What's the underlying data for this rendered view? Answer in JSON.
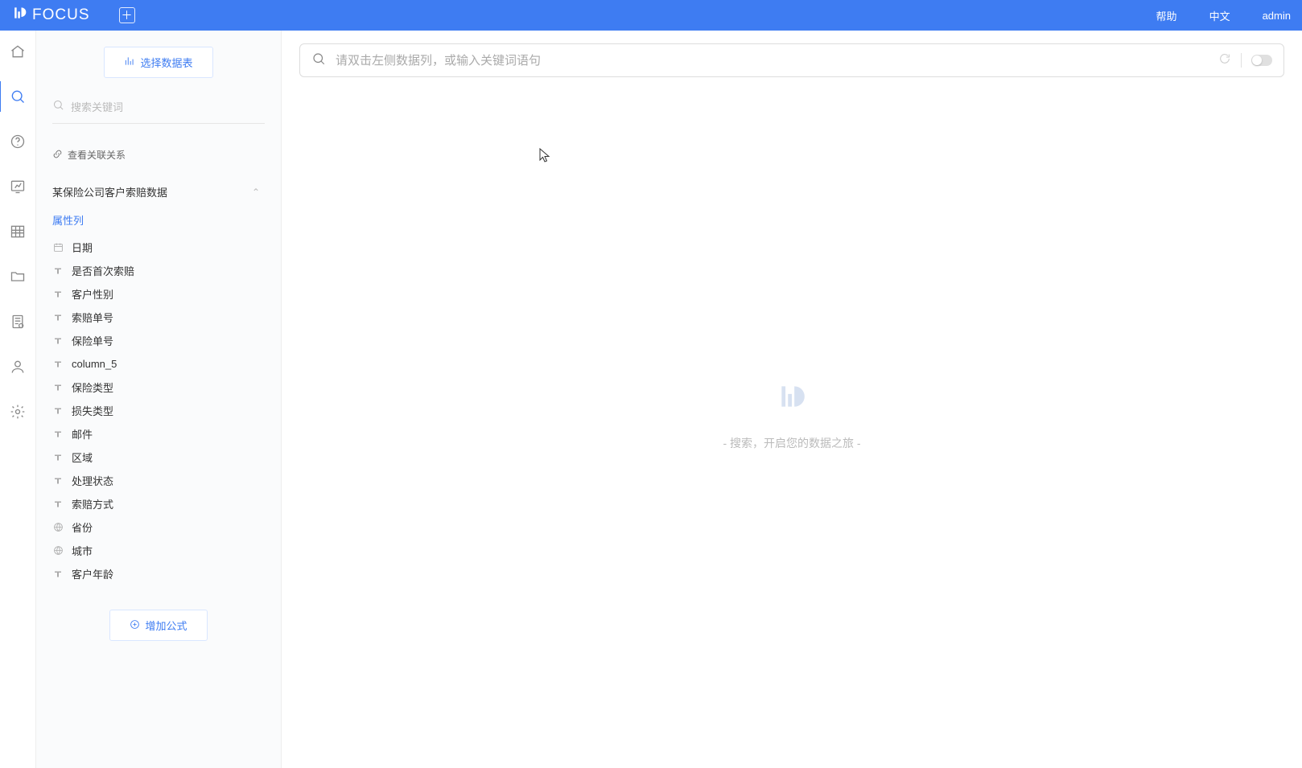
{
  "header": {
    "app_name": "FOCUS",
    "right": {
      "help": "帮助",
      "language": "中文",
      "user": "admin"
    }
  },
  "sidebar": {
    "select_table_btn": "选择数据表",
    "search_placeholder": "搜索关键词",
    "relation_link": "查看关联关系",
    "table_name": "某保险公司客户索赔数据",
    "attr_section_label": "属性列",
    "columns": [
      {
        "type": "date",
        "label": "日期"
      },
      {
        "type": "text",
        "label": "是否首次索赔"
      },
      {
        "type": "text",
        "label": "客户性别"
      },
      {
        "type": "text",
        "label": "索赔单号"
      },
      {
        "type": "text",
        "label": "保险单号"
      },
      {
        "type": "text",
        "label": "column_5"
      },
      {
        "type": "text",
        "label": "保险类型"
      },
      {
        "type": "text",
        "label": "损失类型"
      },
      {
        "type": "text",
        "label": "邮件"
      },
      {
        "type": "text",
        "label": "区域"
      },
      {
        "type": "text",
        "label": "处理状态"
      },
      {
        "type": "text",
        "label": "索赔方式"
      },
      {
        "type": "geo",
        "label": "省份"
      },
      {
        "type": "geo",
        "label": "城市"
      },
      {
        "type": "text",
        "label": "客户年龄"
      }
    ],
    "add_formula_btn": "增加公式"
  },
  "main": {
    "search_placeholder": "请双击左侧数据列，或输入关键词语句",
    "empty_text": "- 搜索，开启您的数据之旅 -"
  }
}
